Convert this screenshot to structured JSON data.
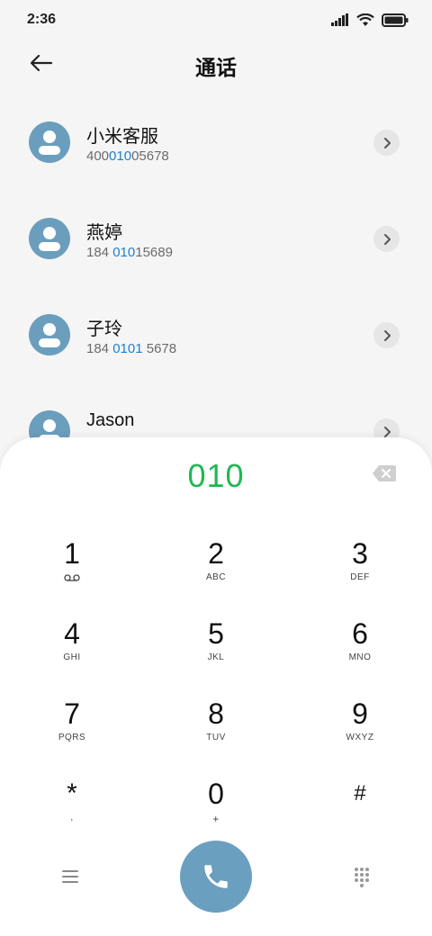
{
  "status_bar": {
    "time": "2:36"
  },
  "header": {
    "title": "通话"
  },
  "contacts": [
    {
      "name": "小米客服",
      "num_pre": "400",
      "num_hl": "010",
      "num_post": "05678"
    },
    {
      "name": "燕婷",
      "num_pre": "184 ",
      "num_hl": "010",
      "num_post": "15689"
    },
    {
      "name": "子玲",
      "num_pre": "184 ",
      "num_hl": "0101",
      "num_post": " 5678"
    },
    {
      "name": "Jason",
      "num_pre": "",
      "num_hl": "",
      "num_post": ""
    }
  ],
  "dialpad": {
    "input": "010",
    "keys": [
      {
        "digit": "1",
        "letters": ""
      },
      {
        "digit": "2",
        "letters": "ABC"
      },
      {
        "digit": "3",
        "letters": "DEF"
      },
      {
        "digit": "4",
        "letters": "GHI"
      },
      {
        "digit": "5",
        "letters": "JKL"
      },
      {
        "digit": "6",
        "letters": "MNO"
      },
      {
        "digit": "7",
        "letters": "PQRS"
      },
      {
        "digit": "8",
        "letters": "TUV"
      },
      {
        "digit": "9",
        "letters": "WXYZ"
      },
      {
        "digit": "*",
        "letters": ","
      },
      {
        "digit": "0",
        "letters": "+"
      },
      {
        "digit": "#",
        "letters": ""
      }
    ]
  },
  "colors": {
    "accent_green": "#1db954",
    "highlight_blue": "#1f7fd1",
    "avatar_blue": "#6b9ebd",
    "call_button": "#6a9fbf"
  }
}
